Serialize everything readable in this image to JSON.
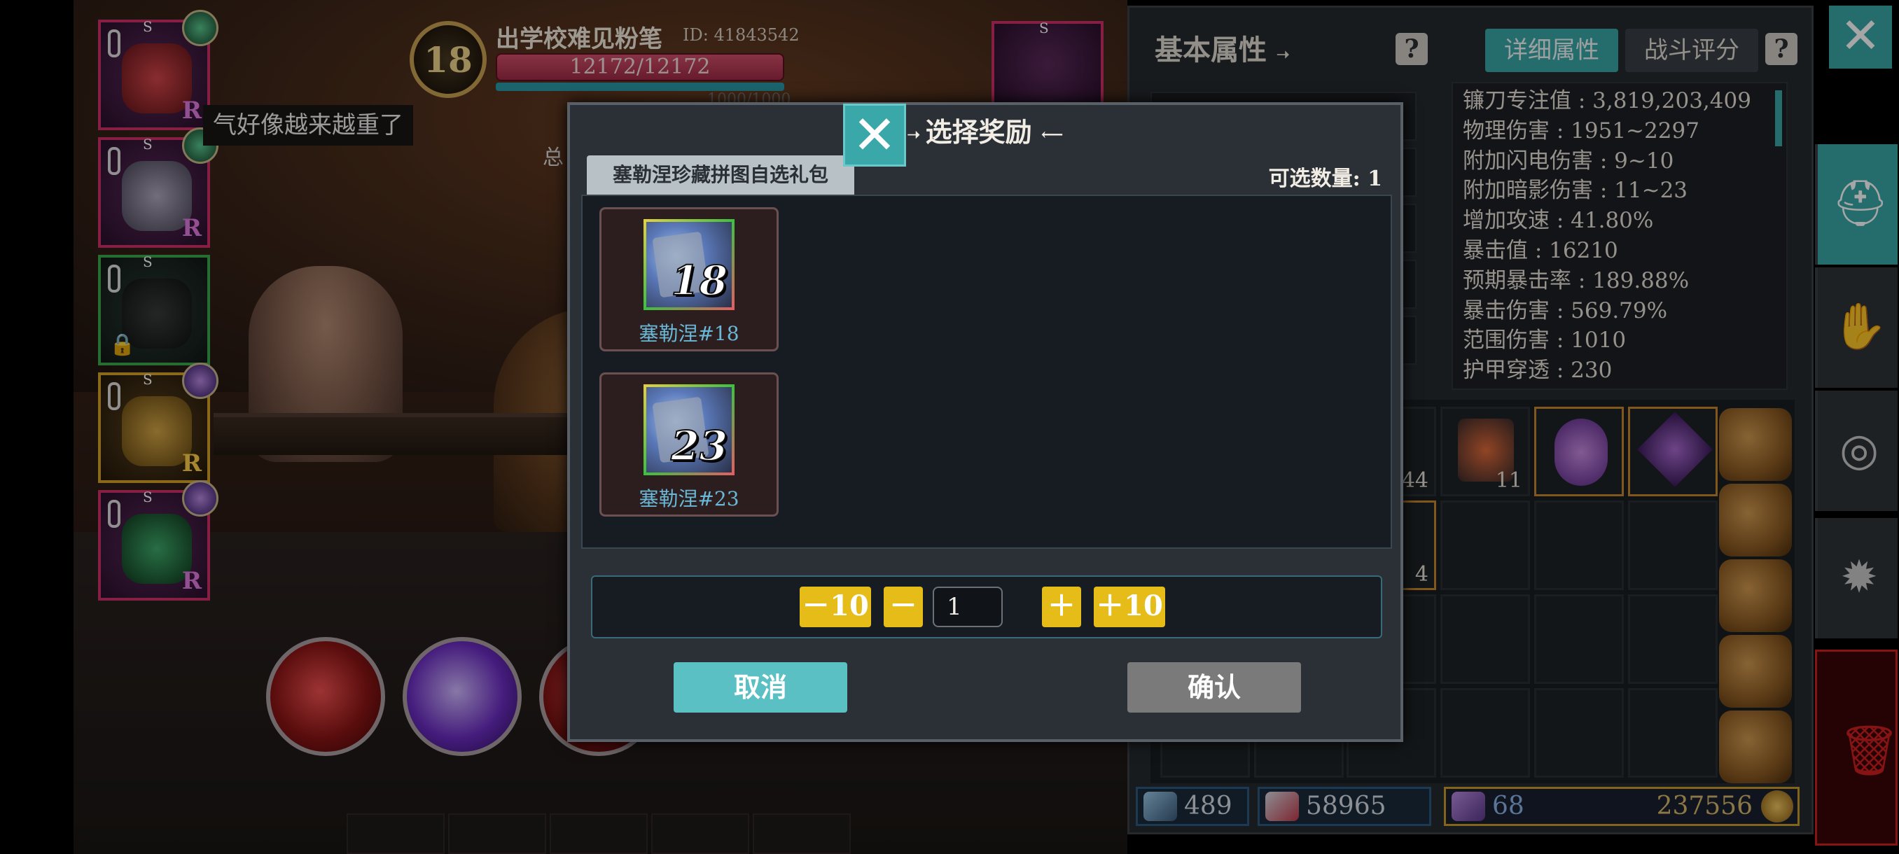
{
  "player": {
    "name": "出学校难见粉笔",
    "id_text": "ID: 41843542",
    "level": "18",
    "hp": "12172/12172",
    "mp": "1000/1000"
  },
  "scene": {
    "speech": "气好像越来越重了",
    "total_fragment": "总"
  },
  "equipment_slots": [
    {
      "label_top": "S",
      "rarity": "R"
    },
    {
      "label_top": "S",
      "rarity": "R"
    },
    {
      "label_top": "S"
    },
    {
      "label_top": "S",
      "rarity": "R"
    },
    {
      "label_top": "S",
      "rarity": "R"
    }
  ],
  "right_equip": {
    "label_top": "S"
  },
  "panel": {
    "tab_basic": "基本属性",
    "tab_detail": "详细属性",
    "tab_score": "战斗评分",
    "help_glyph": "?",
    "stats": [
      "镰刀专注值 : 3,819,203,409",
      "物理伤害 : 1951~2297",
      "附加闪电伤害 : 9~10",
      "附加暗影伤害 : 11~23",
      "增加攻速 : 41.80%",
      "暴击值 : 16210",
      "预期暴击率 : 189.88%",
      "暴击伤害 : 569.79%",
      "范围伤害 : 1010",
      "护甲穿透 : 230"
    ],
    "inventory_counts": {
      "a": "44",
      "b": "11",
      "c": "4"
    },
    "currencies": [
      {
        "value": "489",
        "icon": "wand-icon"
      },
      {
        "value": "58965",
        "icon": "heart-shield-icon"
      },
      {
        "value": "68",
        "icon": "purple-gem-icon"
      },
      {
        "value": "237556",
        "icon": "gold-coin-icon"
      }
    ]
  },
  "modal": {
    "title": "选择奖励",
    "pack_tab": "塞勒涅珍藏拼图自选礼包",
    "select_count": "可选数量: 1",
    "rewards": [
      {
        "number": "18",
        "label": "塞勒涅#18"
      },
      {
        "number": "23",
        "label": "塞勒涅#23"
      }
    ],
    "qty": {
      "minus10": "－10",
      "minus": "－",
      "value": "1",
      "plus": "＋",
      "plus10": "＋10"
    },
    "cancel_label": "取消",
    "confirm_label": "确认"
  },
  "colors": {
    "accent_teal": "#3aa7a8",
    "button_yellow": "#e6bc18",
    "confirm_gray": "#7a7a7a",
    "trash_red": "#d02020"
  }
}
